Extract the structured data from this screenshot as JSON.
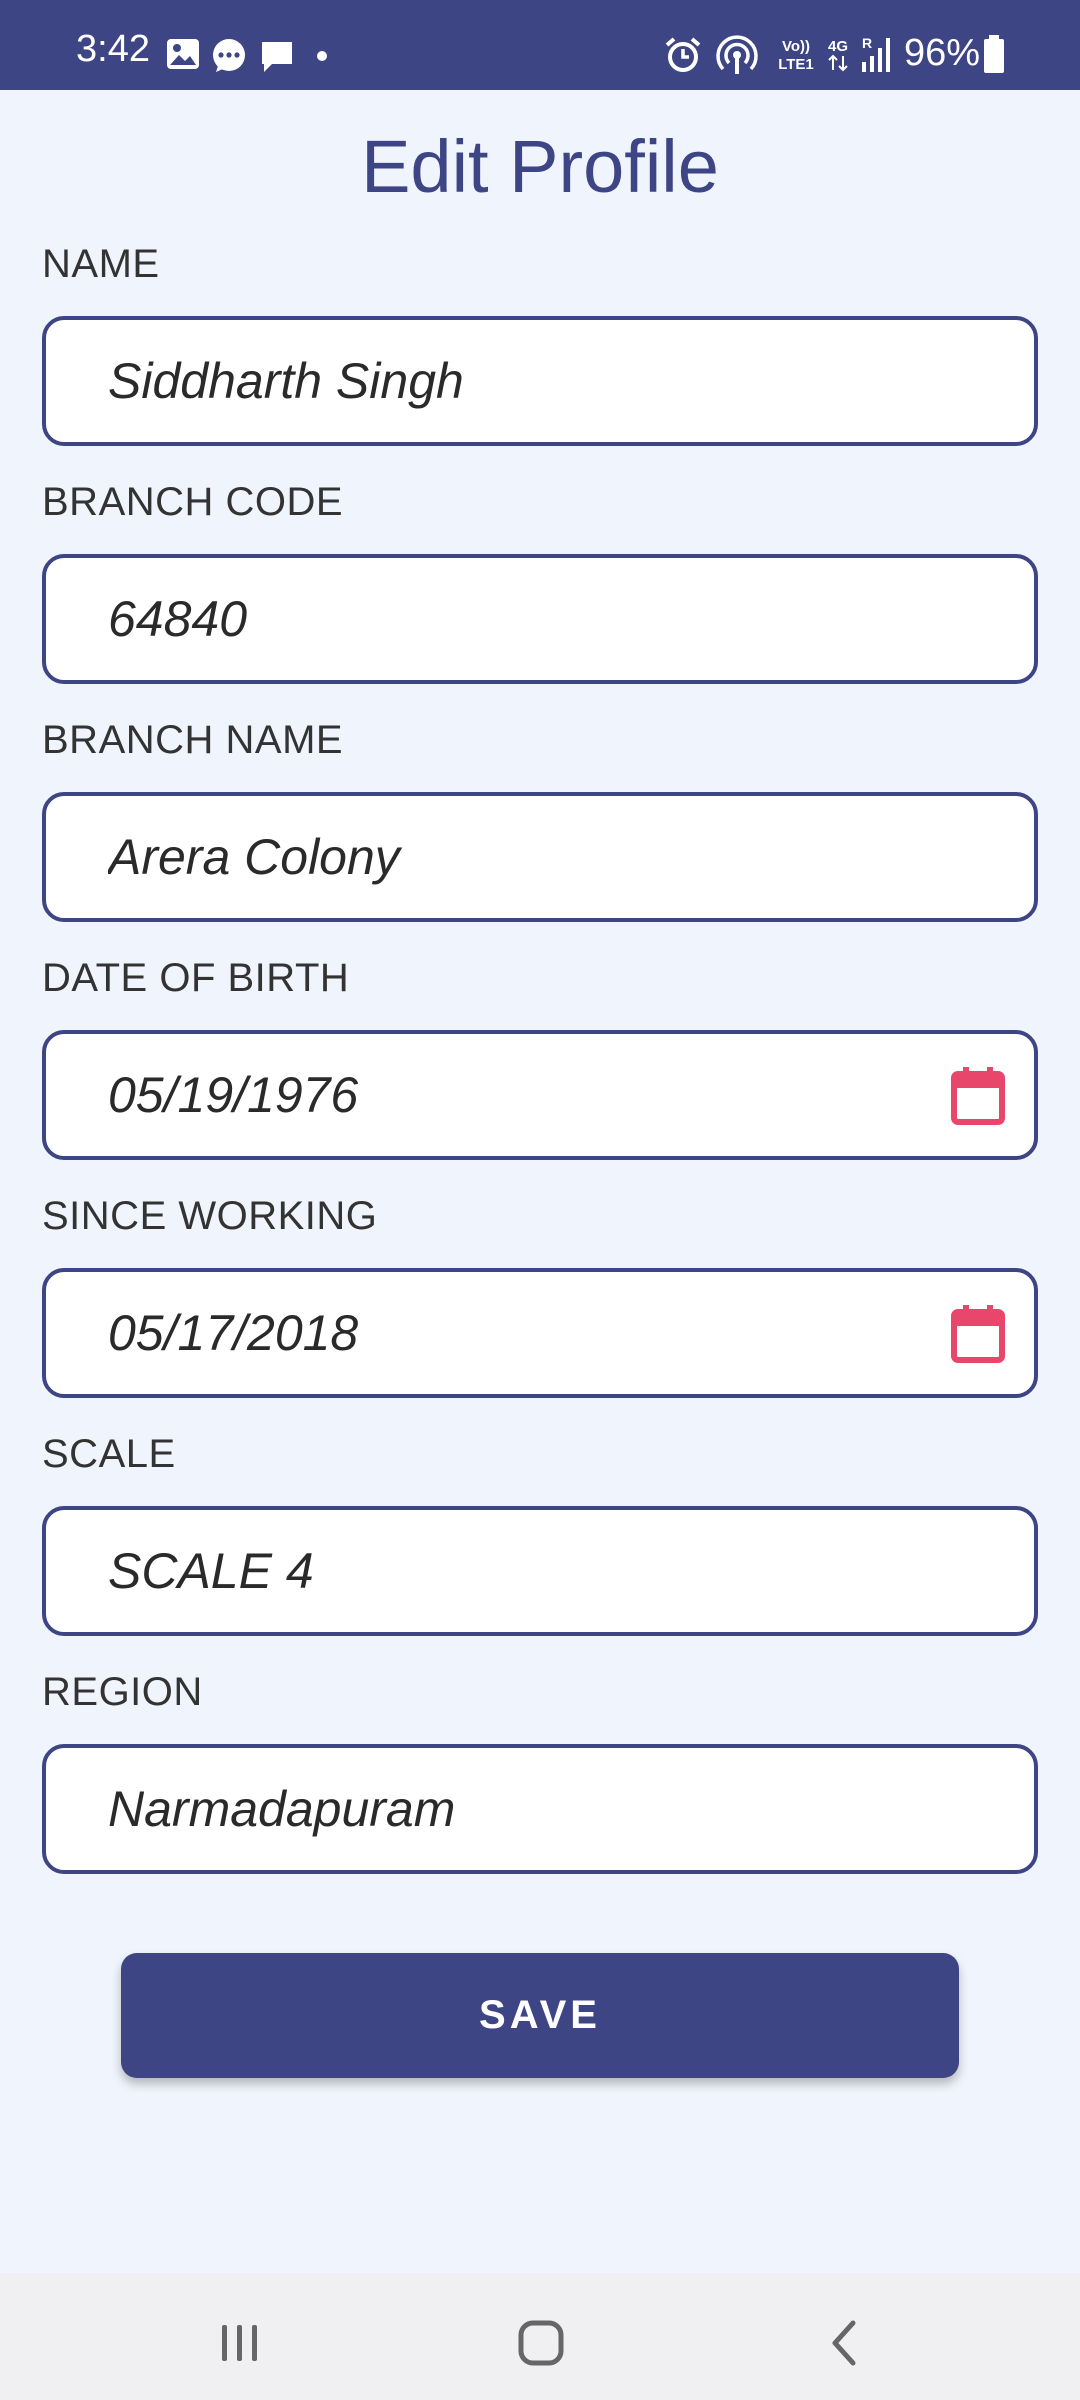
{
  "status_bar": {
    "time": "3:42",
    "battery": "96%",
    "icons_left": [
      "image-icon",
      "messenger-icon",
      "chat-icon",
      "dot-icon"
    ],
    "icons_right": [
      "alarm-icon",
      "hotspot-icon",
      "volte-icon",
      "4g-icon",
      "signal-icon",
      "battery-icon"
    ]
  },
  "page": {
    "title": "Edit Profile"
  },
  "form": {
    "fields": [
      {
        "label": "NAME",
        "value": "Siddharth Singh"
      },
      {
        "label": "BRANCH CODE",
        "value": "64840"
      },
      {
        "label": "BRANCH NAME",
        "value": "Arera Colony"
      },
      {
        "label": "DATE OF BIRTH",
        "value": "05/19/1976"
      },
      {
        "label": "SINCE WORKING",
        "value": "05/17/2018"
      },
      {
        "label": "SCALE",
        "value": "SCALE 4"
      },
      {
        "label": "REGION",
        "value": "Narmadapuram"
      }
    ],
    "save_label": "SAVE"
  },
  "nav": {
    "buttons": [
      "recents-icon",
      "home-icon",
      "back-icon"
    ]
  },
  "colors": {
    "primary": "#3d4585",
    "background": "#f0f4fc",
    "calendar_accent": "#e8466a"
  }
}
